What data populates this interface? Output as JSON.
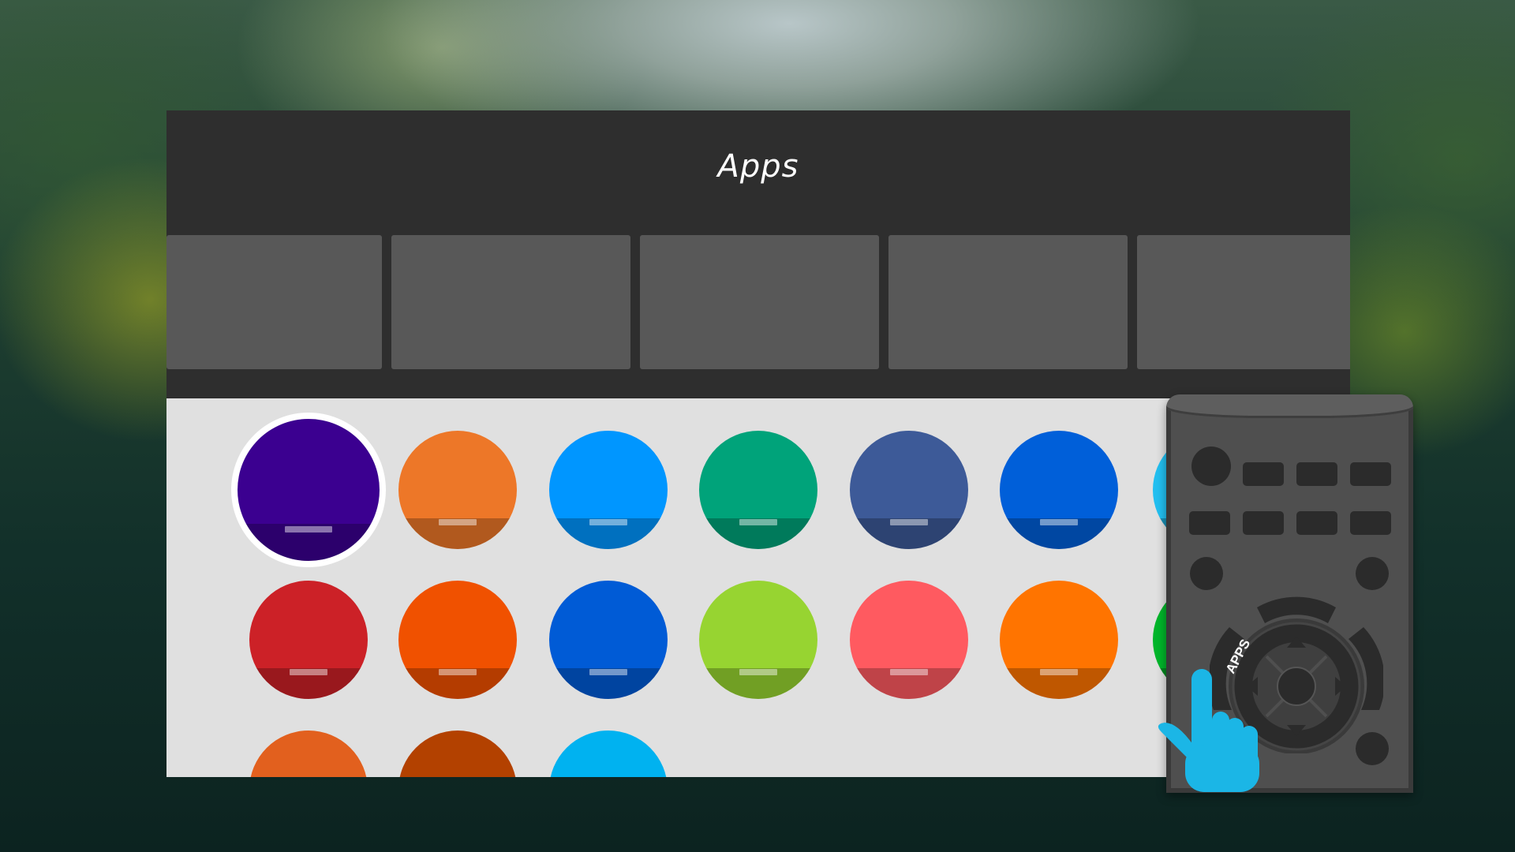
{
  "header": {
    "title": "Apps"
  },
  "tiles_count": 5,
  "apps": {
    "rows": [
      [
        {
          "color": "#3b0090",
          "selected": true
        },
        {
          "color": "#ed7728"
        },
        {
          "color": "#0096ff"
        },
        {
          "color": "#00a37a"
        },
        {
          "color": "#3d5a98"
        },
        {
          "color": "#005fd9"
        },
        {
          "color": "#22bff0"
        }
      ],
      [
        {
          "color": "#cc2127"
        },
        {
          "color": "#f05100"
        },
        {
          "color": "#005bd6"
        },
        {
          "color": "#97d431"
        },
        {
          "color": "#ff5a60"
        },
        {
          "color": "#ff7400"
        },
        {
          "color": "#00b52a"
        }
      ],
      [
        {
          "color": "#e2601e"
        },
        {
          "color": "#b34100"
        },
        {
          "color": "#00b2f0"
        }
      ]
    ]
  },
  "remote": {
    "apps_label": "APPS",
    "accent_color": "#1bb6e6"
  }
}
